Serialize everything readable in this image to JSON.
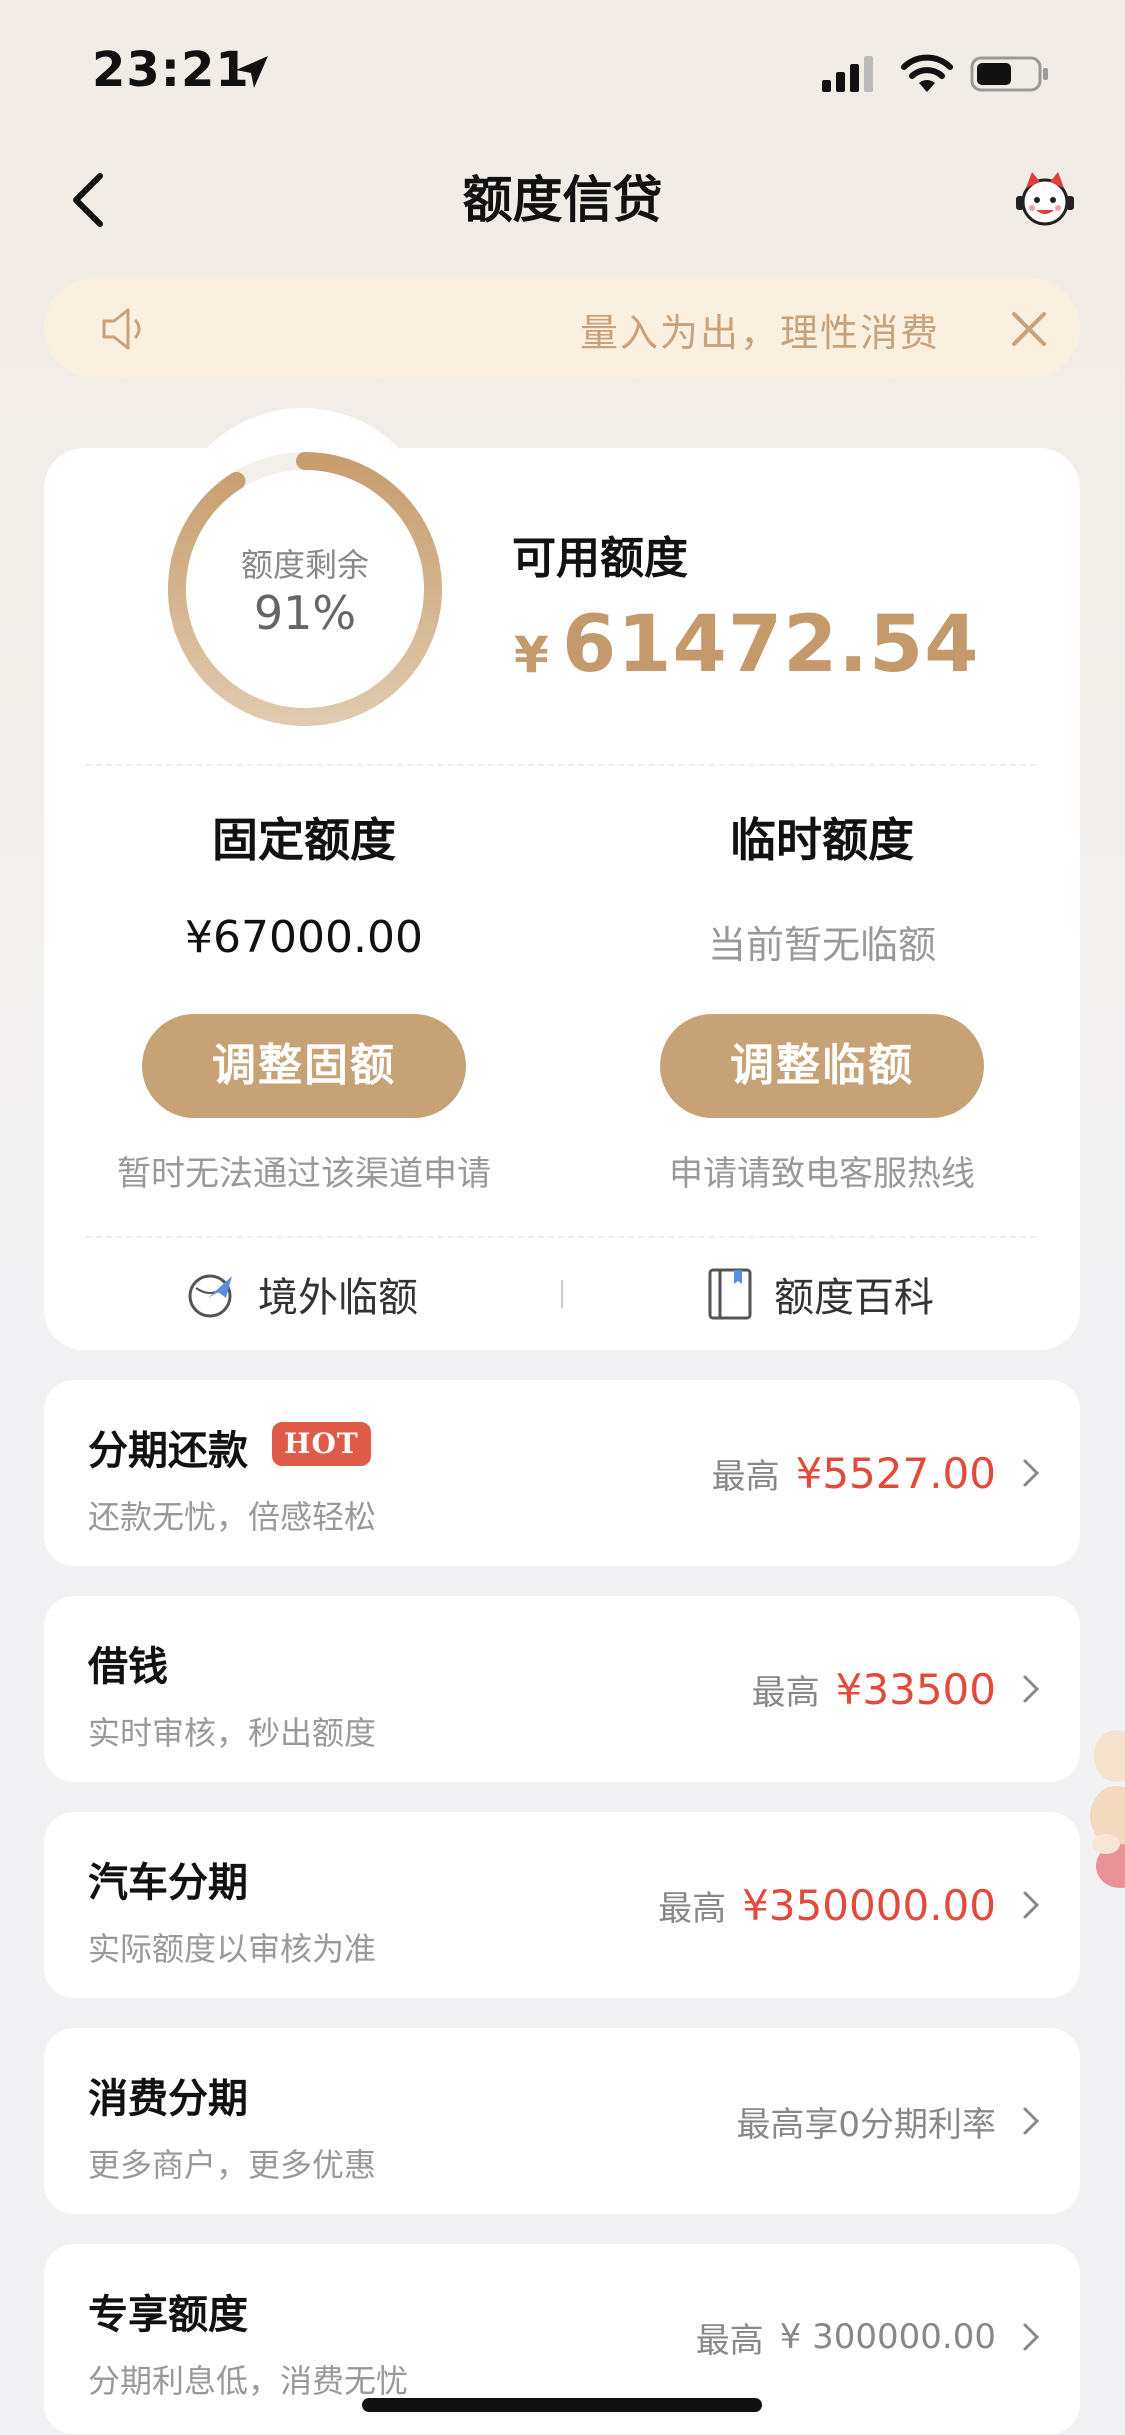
{
  "status_bar": {
    "time": "23:21"
  },
  "nav": {
    "title": "额度信贷"
  },
  "notice": {
    "text": "量入为出，理性消费"
  },
  "credit": {
    "ring_label": "额度剩余",
    "ring_value": "91%",
    "ring_fraction": 0.91,
    "available_label": "可用额度",
    "available_currency": "¥",
    "available_amount": "61472.54",
    "fixed": {
      "label": "固定额度",
      "amount": "¥67000.00",
      "button": "调整固额",
      "note": "暂时无法通过该渠道申请"
    },
    "temp": {
      "label": "临时额度",
      "status": "当前暂无临额",
      "button": "调整临额",
      "note": "申请请致电客服热线"
    },
    "links": {
      "overseas": "境外临额",
      "wiki": "额度百科"
    }
  },
  "products": [
    {
      "title": "分期还款",
      "badge": "HOT",
      "subtitle": "还款无忧，倍感轻松",
      "prefix": "最高",
      "amount": "¥5527.00"
    },
    {
      "title": "借钱",
      "subtitle": "实时审核，秒出额度",
      "prefix": "最高",
      "amount": "¥33500"
    },
    {
      "title": "汽车分期",
      "subtitle": "实际额度以审核为准",
      "prefix": "最高",
      "amount": "¥350000.00"
    },
    {
      "title": "消费分期",
      "subtitle": "更多商户，更多优惠",
      "plain": "最高享0分期利率"
    },
    {
      "title": "专享额度",
      "subtitle": "分期利息低，消费无忧",
      "prefix": "最高",
      "amount": "¥ 300000.00"
    }
  ],
  "colors": {
    "gold": "#c7a276",
    "red": "#e24a3b",
    "notice_bg": "#faf0df"
  }
}
